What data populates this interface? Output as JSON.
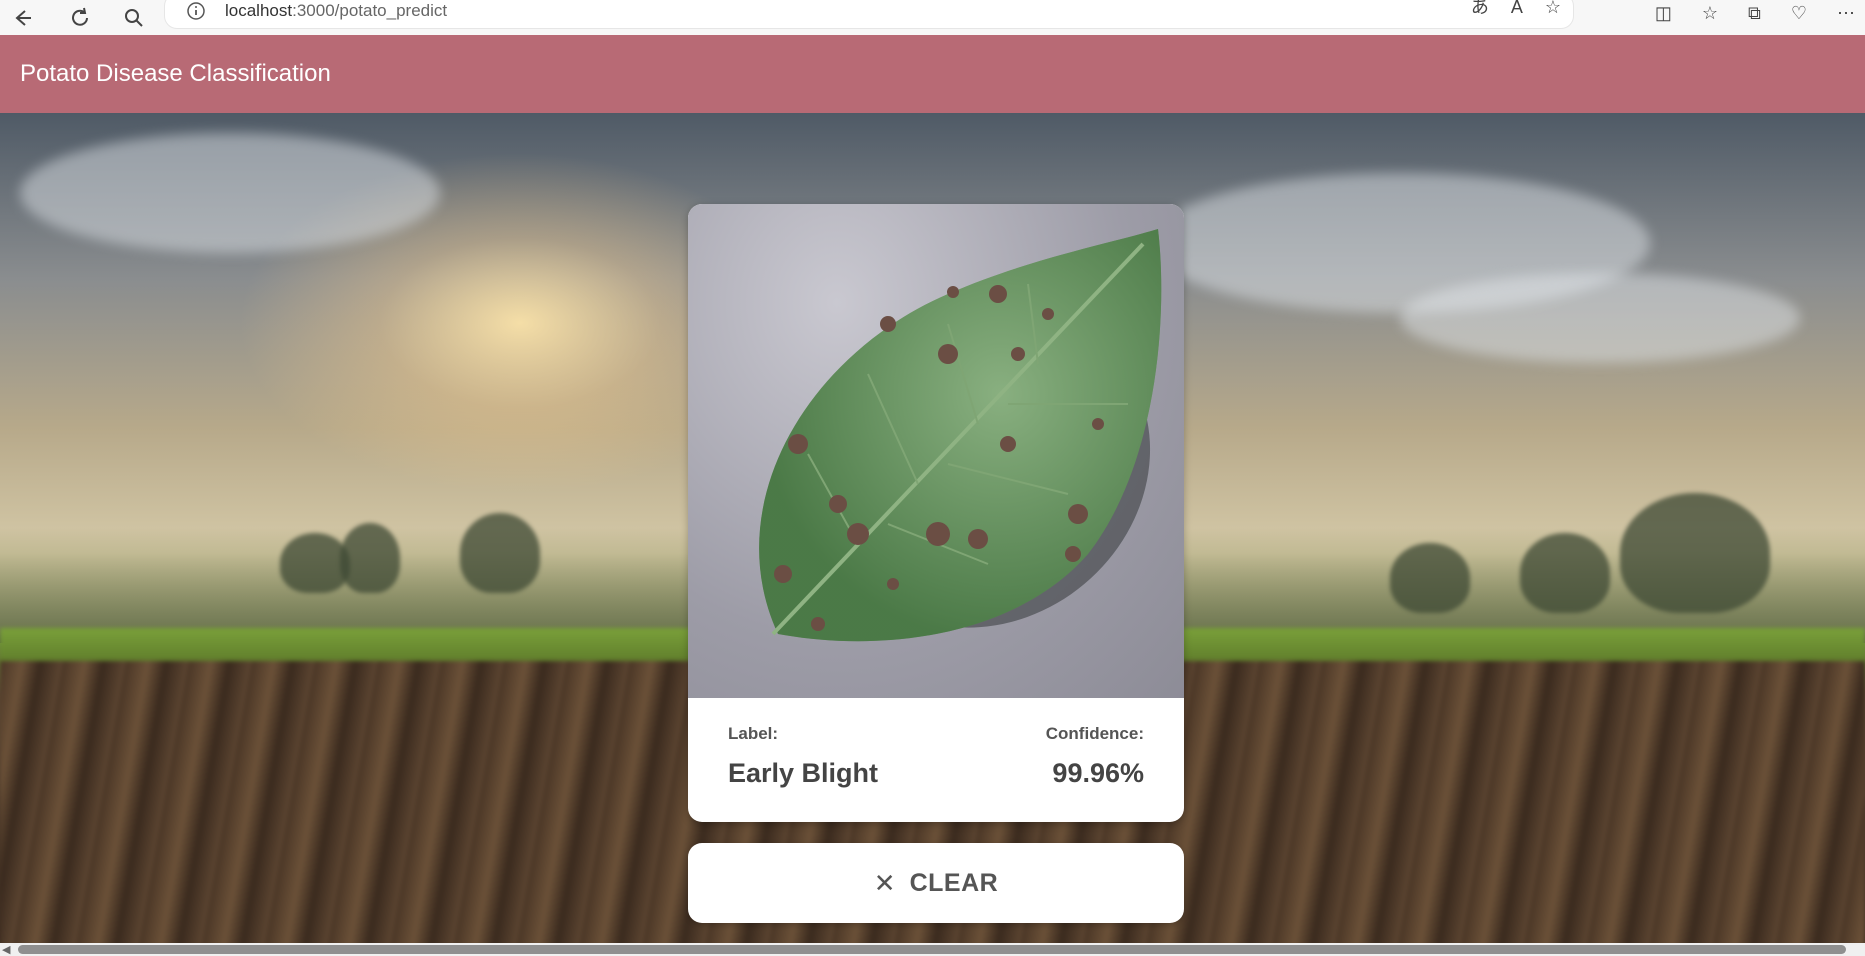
{
  "browser": {
    "url_host": "localhost",
    "url_path": ":3000/potato_predict",
    "icons": [
      "back-icon",
      "refresh-icon",
      "search-icon",
      "info-icon",
      "read-aloud-icon",
      "text-icon",
      "favorite-star-icon",
      "split-screen-icon",
      "favorites-icon",
      "collections-icon",
      "health-icon",
      "more-icon"
    ]
  },
  "header": {
    "title": "Potato Disease Classification"
  },
  "result": {
    "label_title": "Label:",
    "label_value": "Early Blight",
    "confidence_title": "Confidence:",
    "confidence_value": "99.96%"
  },
  "actions": {
    "clear_label": "CLEAR",
    "clear_icon": "close-icon"
  },
  "colors": {
    "header_bg": "#b86a75",
    "card_bg": "#ffffff",
    "text_dark": "#444444"
  }
}
